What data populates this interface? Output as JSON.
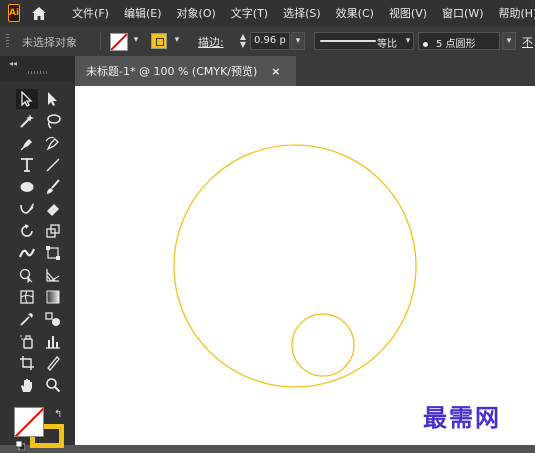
{
  "menubar": {
    "logo_text": "Ai",
    "home_icon": "home-icon",
    "items": [
      "文件(F)",
      "编辑(E)",
      "对象(O)",
      "文字(T)",
      "选择(S)",
      "效果(C)",
      "视图(V)",
      "窗口(W)",
      "帮助(H)"
    ]
  },
  "controlbar": {
    "selection_status": "未选择对象",
    "fill": "none",
    "stroke_color": "#f2c21b",
    "stroke_label": "描边",
    "stroke_colon": ":",
    "stroke_weight": "0.96 p",
    "variable_width_label": "等比",
    "brush_label": "5 点圆形",
    "opacity_label": "不"
  },
  "document": {
    "tab_title": "未标题-1* @ 100 % (CMYK/预览)",
    "tab_close": "×"
  },
  "artwork": {
    "stroke_color": "#f2c21b",
    "shapes": [
      "large-circle",
      "small-circle"
    ]
  },
  "watermark": "最需网",
  "colors": {
    "accent_yellow": "#f2c21b",
    "ui_dark": "#323232",
    "ui_mid": "#535353",
    "watermark": "#4a2fcf"
  }
}
